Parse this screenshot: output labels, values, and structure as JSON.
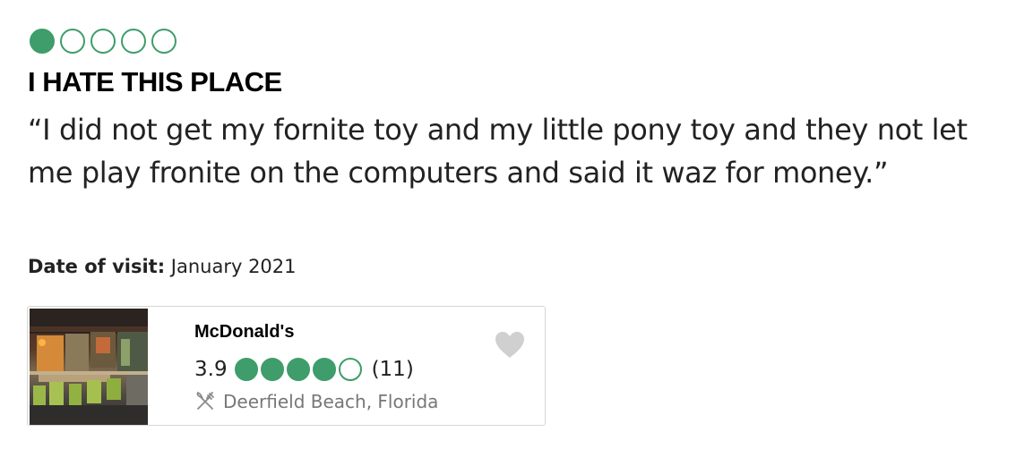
{
  "review": {
    "rating": 1,
    "rating_max": 5,
    "title": "I HATE THIS PLACE",
    "body": "“I did not get my fornite toy and my little pony toy and they not let me play fronite on the computers and said it waz for money.”",
    "visit_label": "Date of visit:",
    "visit_value": "January 2021"
  },
  "place_card": {
    "name": "McDonald's",
    "rating_text": "3.9",
    "bubbles_filled": 4,
    "bubbles_total": 5,
    "review_count": "(11)",
    "location": "Deerfield Beach, Florida",
    "category_icon": "cutlery-icon",
    "save_icon": "heart-icon",
    "photo_description_icon": "restaurant-photo"
  },
  "colors": {
    "bubble_green": "#3e9d6a",
    "heart_gray": "#d0d0d0",
    "muted_text": "#777777",
    "card_border": "#d6d6d6"
  }
}
